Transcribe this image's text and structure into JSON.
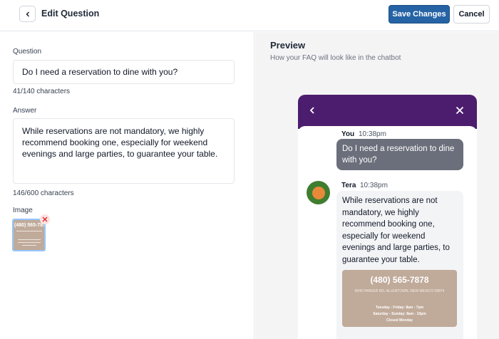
{
  "header": {
    "title": "Edit Question",
    "save_label": "Save Changes",
    "cancel_label": "Cancel"
  },
  "form": {
    "question_label": "Question",
    "question_value": "Do I need a reservation to dine with you?",
    "question_counter": "41/140 characters",
    "answer_label": "Answer",
    "answer_lines": [
      "While reservations are not mandatory, we highly",
      "recommend booking one, especially for weekend",
      "evenings and large parties, to guarantee your table."
    ],
    "answer_counter": "146/600 characters",
    "image_label": "Image",
    "thumb_phone": "(480) 565-787"
  },
  "preview": {
    "title": "Preview",
    "subtitle": "How your FAQ will look like in the chatbot",
    "user_name": "You",
    "user_time": "10:38pm",
    "user_message_lines": [
      "Do I need a reservation to dine",
      "with you?"
    ],
    "bot_name": "Tera",
    "bot_time": "10:38pm",
    "bot_message_lines": [
      "While reservations are not",
      "mandatory, we highly",
      "recommend booking one,",
      "especially for weekend",
      "evenings and large parties, to",
      "guarantee your table."
    ],
    "image_phone": "(480) 565-7878",
    "image_address": "9945 PARKER RD, ALLENTOWN, NEW MEXICO 58874",
    "image_hours": [
      "Tuesday - Friday: 8am - 7pm",
      "Saturday - Sunday: 8am - 10pm",
      "Closed Monday"
    ]
  },
  "colors": {
    "primary": "#2563a5",
    "chat_header": "#4c1d6e",
    "user_bubble": "#6b6f7b",
    "image_bg": "#c0aa9a"
  },
  "icons": {
    "back": "chevron-left-icon",
    "close": "close-icon",
    "remove": "remove-x-icon"
  }
}
